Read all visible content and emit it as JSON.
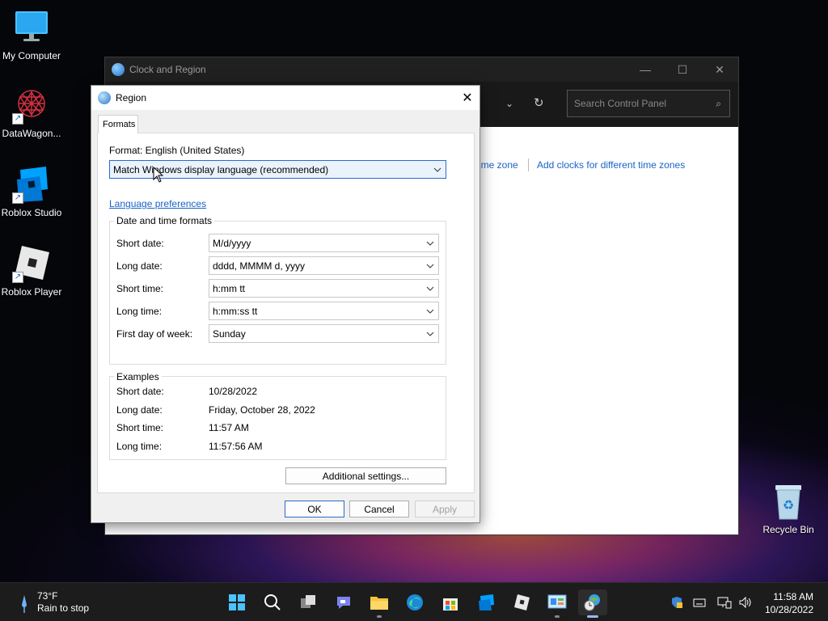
{
  "desktop": {
    "icons": [
      {
        "label": "My Computer",
        "icon": "monitor-icon"
      },
      {
        "label": "DataWagon...",
        "icon": "datawagon-icon"
      },
      {
        "label": "Roblox Studio",
        "icon": "roblox-studio-icon"
      },
      {
        "label": "Roblox Player",
        "icon": "roblox-player-icon"
      },
      {
        "label": "Recycle Bin",
        "icon": "recycle-bin-icon"
      }
    ]
  },
  "control_panel": {
    "title": "Clock and Region",
    "search_placeholder": "Search Control Panel",
    "links": [
      "ime zone",
      "Add clocks for different time zones"
    ]
  },
  "region_dialog": {
    "title": "Region",
    "tab": "Formats",
    "format_label": "Format: English (United States)",
    "format_value": "Match Windows display language (recommended)",
    "language_link": "Language preferences",
    "date_time_group": "Date and time formats",
    "fields": [
      {
        "label": "Short date:",
        "value": "M/d/yyyy"
      },
      {
        "label": "Long date:",
        "value": "dddd, MMMM d, yyyy"
      },
      {
        "label": "Short time:",
        "value": "h:mm tt"
      },
      {
        "label": "Long time:",
        "value": "h:mm:ss tt"
      },
      {
        "label": "First day of week:",
        "value": "Sunday"
      }
    ],
    "examples_group": "Examples",
    "examples": [
      {
        "label": "Short date:",
        "value": "10/28/2022"
      },
      {
        "label": "Long date:",
        "value": "Friday, October 28, 2022"
      },
      {
        "label": "Short time:",
        "value": "11:57 AM"
      },
      {
        "label": "Long time:",
        "value": "11:57:56 AM"
      }
    ],
    "additional_settings": "Additional settings...",
    "ok": "OK",
    "cancel": "Cancel",
    "apply": "Apply"
  },
  "taskbar": {
    "weather_temp": "73°F",
    "weather_desc": "Rain to stop",
    "time": "11:58 AM",
    "date": "10/28/2022",
    "apps": [
      "windows-start-icon",
      "search-icon",
      "task-view-icon",
      "chat-icon",
      "file-explorer-icon",
      "edge-icon",
      "store-icon",
      "roblox-studio-icon",
      "roblox-player-icon",
      "control-panel-icon",
      "region-icon"
    ]
  }
}
